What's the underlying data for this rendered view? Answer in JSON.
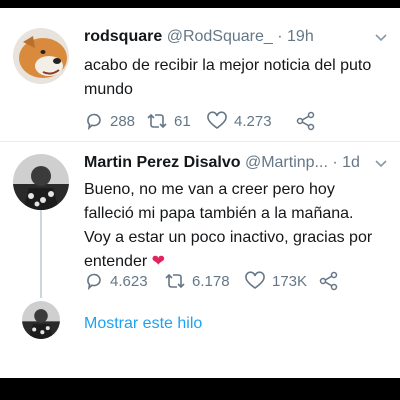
{
  "tweets": [
    {
      "name": "rodsquare",
      "handle": "@RodSquare_",
      "time": "· 19h",
      "text_lines": [
        "acabo de recibir la mejor noticia del puto",
        "mundo"
      ],
      "replies": "288",
      "retweets": "61",
      "likes": "4.273"
    },
    {
      "name": "Martin Perez Disalvo",
      "handle": "@Martinp...",
      "time": "· 1d",
      "text_lines": [
        "Bueno, no me van a creer pero hoy",
        "falleció mi papa también a la mañana.",
        "Voy a estar un poco inactivo, gracias por",
        "entender"
      ],
      "replies": "4.623",
      "retweets": "6.178",
      "likes": "173K"
    }
  ],
  "thread": {
    "show_label": "Mostrar este hilo"
  },
  "colors": {
    "link": "#1da1f2",
    "heart": "#e0245e",
    "muted": "#657786"
  }
}
